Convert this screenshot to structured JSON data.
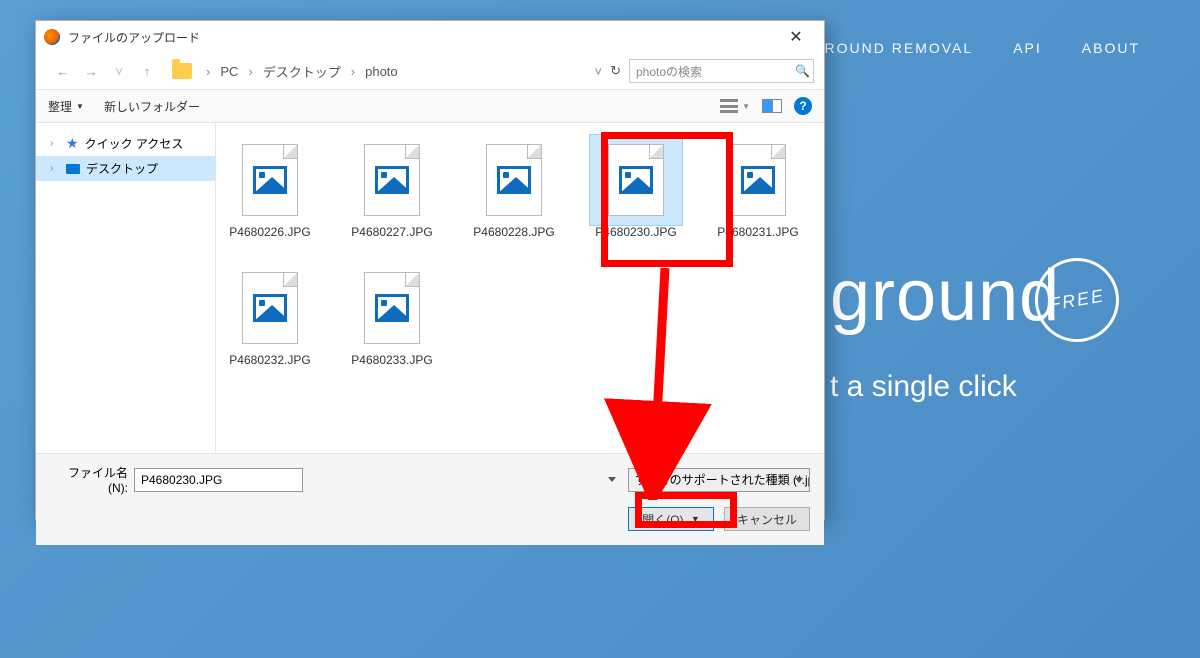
{
  "bg": {
    "nav": [
      "GROUND REMOVAL",
      "API",
      "ABOUT"
    ],
    "heading": "ground",
    "free": "FREE",
    "sub": "t a single click"
  },
  "dialog": {
    "title": "ファイルのアップロード",
    "breadcrumb": {
      "pc": "PC",
      "desktop": "デスクトップ",
      "folder": "photo"
    },
    "search_placeholder": "photoの検索",
    "toolbar": {
      "organize": "整理",
      "newfolder": "新しいフォルダー"
    },
    "sidebar": {
      "quick": "クイック アクセス",
      "desktop": "デスクトップ"
    },
    "files": [
      "P4680226.JPG",
      "P4680227.JPG",
      "P4680228.JPG",
      "P4680230.JPG",
      "P4680231.JPG",
      "P4680232.JPG",
      "P4680233.JPG"
    ],
    "selected_index": 3,
    "filename_label": "ファイル名(N):",
    "filename_value": "P4680230.JPG",
    "filetype": "すべてのサポートされた種類 (*.jpg;*",
    "open": "開く(O)",
    "cancel": "キャンセル"
  },
  "annotations": {
    "color": "#ff0000"
  }
}
